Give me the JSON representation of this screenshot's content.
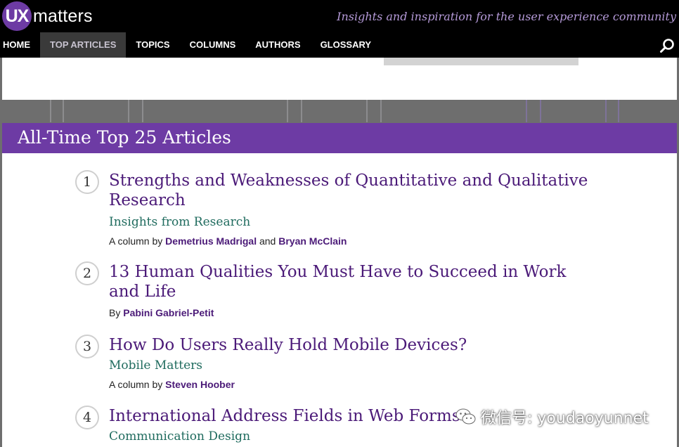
{
  "header": {
    "logo_mark": "UX",
    "logo_word": "matters",
    "tagline": "Insights and inspiration for the user experience community"
  },
  "nav": {
    "items": [
      {
        "label": "HOME"
      },
      {
        "label": "TOP ARTICLES",
        "active": true
      },
      {
        "label": "TOPICS"
      },
      {
        "label": "COLUMNS"
      },
      {
        "label": "AUTHORS"
      },
      {
        "label": "GLOSSARY"
      }
    ],
    "search_icon": "search-icon"
  },
  "section": {
    "title": "All-Time Top 25 Articles"
  },
  "articles": [
    {
      "number": "1",
      "title": "Strengths and Weaknesses of Quantitative and Qualitative Research",
      "column": "Insights from Research",
      "byline_prefix": "A column by",
      "author1": "Demetrius Madrigal",
      "joiner": "and",
      "author2": "Bryan McClain"
    },
    {
      "number": "2",
      "title": "13 Human Qualities You Must Have to Succeed in Work and Life",
      "byline_prefix": "By",
      "author1": "Pabini Gabriel-Petit"
    },
    {
      "number": "3",
      "title": "How Do Users Really Hold Mobile Devices?",
      "column": "Mobile Matters",
      "byline_prefix": "A column by",
      "author1": "Steven Hoober"
    },
    {
      "number": "4",
      "title": "International Address Fields in Web Forms",
      "column": "Communication Design"
    }
  ],
  "watermark": {
    "text": "微信号: youdaoyunnet",
    "icon": "wechat-icon"
  },
  "colors": {
    "brand_purple": "#6d3ba4",
    "title_purple": "#4b1a78",
    "column_green": "#1f6b5e"
  }
}
